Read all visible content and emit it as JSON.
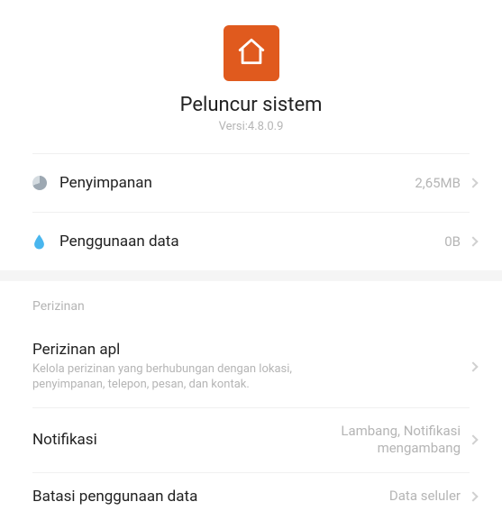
{
  "header": {
    "app_name": "Peluncur sistem",
    "version_label": "Versi:4.8.0.9",
    "icon": "home-icon",
    "icon_bg": "#e05a1e"
  },
  "storage": {
    "label": "Penyimpanan",
    "value": "2,65MB",
    "icon": "pie-chart-icon"
  },
  "data_usage": {
    "label": "Penggunaan data",
    "value": "0B",
    "icon": "water-drop-icon"
  },
  "permissions_section": {
    "header": "Perizinan",
    "items": [
      {
        "title": "Perizinan apl",
        "sub": "Kelola perizinan yang berhubungan dengan lokasi, penyimpanan, telepon, pesan, dan kontak.",
        "value": ""
      },
      {
        "title": "Notifikasi",
        "sub": "",
        "value": "Lambang, Notifikasi mengambang"
      },
      {
        "title": "Batasi penggunaan data",
        "sub": "",
        "value": "Data seluler"
      }
    ]
  }
}
